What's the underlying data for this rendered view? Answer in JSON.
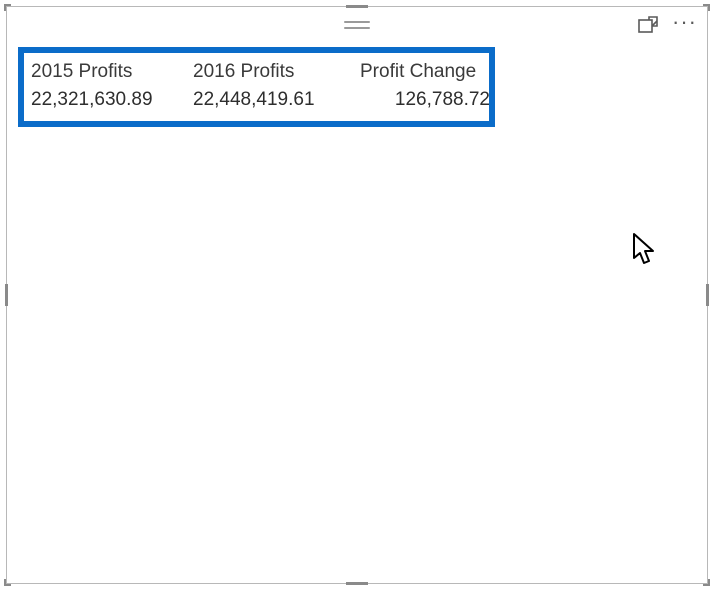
{
  "table": {
    "headers": [
      "2015 Profits",
      "2016 Profits",
      "Profit Change"
    ],
    "rows": [
      [
        "22,321,630.89",
        "22,448,419.61",
        "126,788.72"
      ]
    ]
  },
  "highlight_color": "#0b6cc9"
}
